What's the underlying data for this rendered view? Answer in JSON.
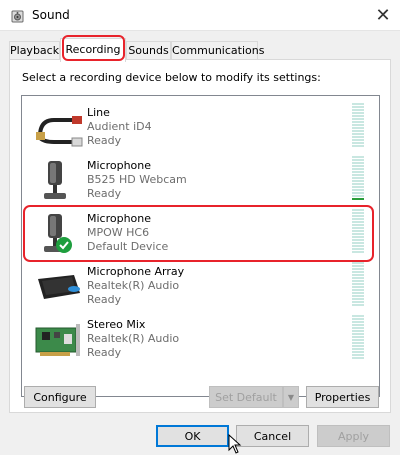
{
  "window": {
    "title": "Sound",
    "close_label": "✕"
  },
  "tabs": [
    {
      "label": "Playback",
      "active": false
    },
    {
      "label": "Recording",
      "active": true
    },
    {
      "label": "Sounds",
      "active": false
    },
    {
      "label": "Communications",
      "active": false
    }
  ],
  "instruction": "Select a recording device below to modify its settings:",
  "devices": [
    {
      "name": "Line",
      "detail": "Audient iD4",
      "status": "Ready",
      "icon": "line-in-icon",
      "level": 0
    },
    {
      "name": "Microphone",
      "detail": "B525 HD Webcam",
      "status": "Ready",
      "icon": "microphone-icon",
      "level": 1
    },
    {
      "name": "Microphone",
      "detail": "MPOW HC6",
      "status": "Default Device",
      "icon": "microphone-default-icon",
      "level": 0,
      "default": true
    },
    {
      "name": "Microphone Array",
      "detail": "Realtek(R) Audio",
      "status": "Ready",
      "icon": "microphone-array-icon",
      "level": 0
    },
    {
      "name": "Stereo Mix",
      "detail": "Realtek(R) Audio",
      "status": "Ready",
      "icon": "sound-card-icon",
      "level": 0
    }
  ],
  "buttons": {
    "configure": "Configure",
    "set_default": "Set Default",
    "properties": "Properties",
    "ok": "OK",
    "cancel": "Cancel",
    "apply": "Apply"
  },
  "colors": {
    "annotation": "#e8232b",
    "meter_idle": "#c9e7e1",
    "meter_active": "#2a9d3a",
    "default_check": "#1e9e3e"
  }
}
